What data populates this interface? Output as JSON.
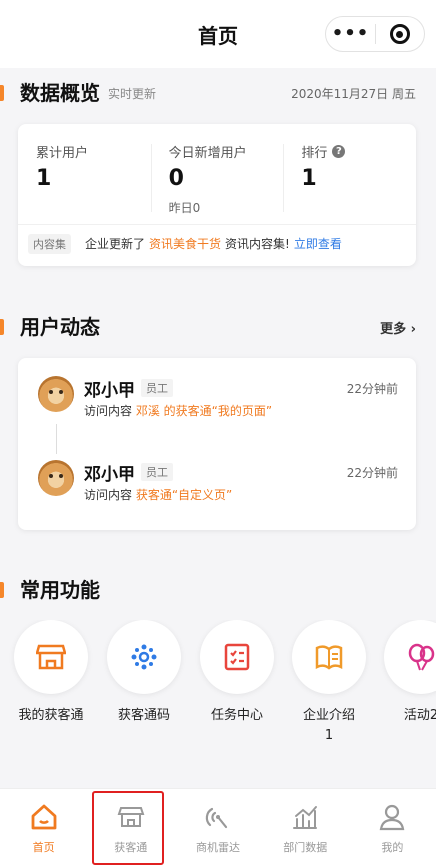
{
  "topbar": {
    "title": "首页",
    "more_glyph": "•••",
    "target_icon": "target-icon"
  },
  "overview": {
    "title": "数据概览",
    "subtitle": "实时更新",
    "date": "2020年11月27日 周五",
    "stats": [
      {
        "label": "累计用户",
        "value": "1",
        "extra": ""
      },
      {
        "label": "今日新增用户",
        "value": "0",
        "extra": "昨日0"
      },
      {
        "label": "排行",
        "value": "1",
        "extra": ""
      }
    ],
    "news": {
      "tag": "内容集",
      "text1": "企业更新了",
      "text2": "资讯美食干货",
      "text3": "资讯内容集!",
      "link": "立即查看"
    }
  },
  "activity": {
    "title": "用户动态",
    "more": "更多",
    "items": [
      {
        "name": "邓小甲",
        "role": "员工",
        "time": "22分钟前",
        "prefix": "访问内容",
        "highlight": "邓溪 的获客通“我的页面”"
      },
      {
        "name": "邓小甲",
        "role": "员工",
        "time": "22分钟前",
        "prefix": "访问内容",
        "highlight": "获客通“自定义页”"
      }
    ]
  },
  "functions": {
    "title": "常用功能",
    "items": [
      {
        "label": "我的获客通",
        "icon": "store-icon"
      },
      {
        "label": "获客通码",
        "icon": "qr-code-icon"
      },
      {
        "label": "任务中心",
        "icon": "task-list-icon"
      },
      {
        "label": "企业介绍\n1",
        "icon": "book-icon"
      },
      {
        "label": "活动2",
        "icon": "balloon-icon"
      }
    ]
  },
  "tabbar": {
    "items": [
      {
        "label": "首页",
        "icon": "home-icon",
        "active": true
      },
      {
        "label": "获客通",
        "icon": "store-icon",
        "active": false
      },
      {
        "label": "商机雷达",
        "icon": "radar-icon",
        "active": false
      },
      {
        "label": "部门数据",
        "icon": "chart-icon",
        "active": false
      },
      {
        "label": "我的",
        "icon": "user-icon",
        "active": false
      }
    ]
  },
  "colors": {
    "accent": "#f07a20",
    "link": "#2f7be5",
    "highlight_border": "#e02020"
  }
}
